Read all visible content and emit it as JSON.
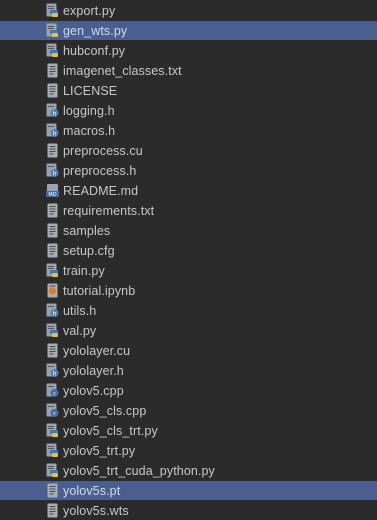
{
  "files": [
    {
      "name": "export.py",
      "icon": "python-file-icon",
      "selected": false
    },
    {
      "name": "gen_wts.py",
      "icon": "python-file-icon",
      "selected": true
    },
    {
      "name": "hubconf.py",
      "icon": "python-file-icon",
      "selected": false
    },
    {
      "name": "imagenet_classes.txt",
      "icon": "text-file-icon",
      "selected": false
    },
    {
      "name": "LICENSE",
      "icon": "text-file-icon",
      "selected": false
    },
    {
      "name": "logging.h",
      "icon": "header-file-icon",
      "selected": false
    },
    {
      "name": "macros.h",
      "icon": "header-file-icon",
      "selected": false
    },
    {
      "name": "preprocess.cu",
      "icon": "text-file-icon",
      "selected": false
    },
    {
      "name": "preprocess.h",
      "icon": "header-file-icon",
      "selected": false
    },
    {
      "name": "README.md",
      "icon": "markdown-file-icon",
      "selected": false
    },
    {
      "name": "requirements.txt",
      "icon": "text-file-icon",
      "selected": false
    },
    {
      "name": "samples",
      "icon": "text-file-icon",
      "selected": false
    },
    {
      "name": "setup.cfg",
      "icon": "text-file-icon",
      "selected": false
    },
    {
      "name": "train.py",
      "icon": "python-file-icon",
      "selected": false
    },
    {
      "name": "tutorial.ipynb",
      "icon": "notebook-file-icon",
      "selected": false
    },
    {
      "name": "utils.h",
      "icon": "header-file-icon",
      "selected": false
    },
    {
      "name": "val.py",
      "icon": "python-file-icon",
      "selected": false
    },
    {
      "name": "yololayer.cu",
      "icon": "text-file-icon",
      "selected": false
    },
    {
      "name": "yololayer.h",
      "icon": "header-file-icon",
      "selected": false
    },
    {
      "name": "yolov5.cpp",
      "icon": "cpp-file-icon",
      "selected": false
    },
    {
      "name": "yolov5_cls.cpp",
      "icon": "cpp-file-icon",
      "selected": false
    },
    {
      "name": "yolov5_cls_trt.py",
      "icon": "python-file-icon",
      "selected": false
    },
    {
      "name": "yolov5_trt.py",
      "icon": "python-file-icon",
      "selected": false
    },
    {
      "name": "yolov5_trt_cuda_python.py",
      "icon": "python-file-icon",
      "selected": false
    },
    {
      "name": "yolov5s.pt",
      "icon": "text-file-icon",
      "selected": true
    },
    {
      "name": "yolov5s.wts",
      "icon": "text-file-icon",
      "selected": false
    }
  ],
  "colors": {
    "background": "#2b2b2b",
    "selection": "#4a5f8f",
    "text": "#c8c8c8"
  }
}
